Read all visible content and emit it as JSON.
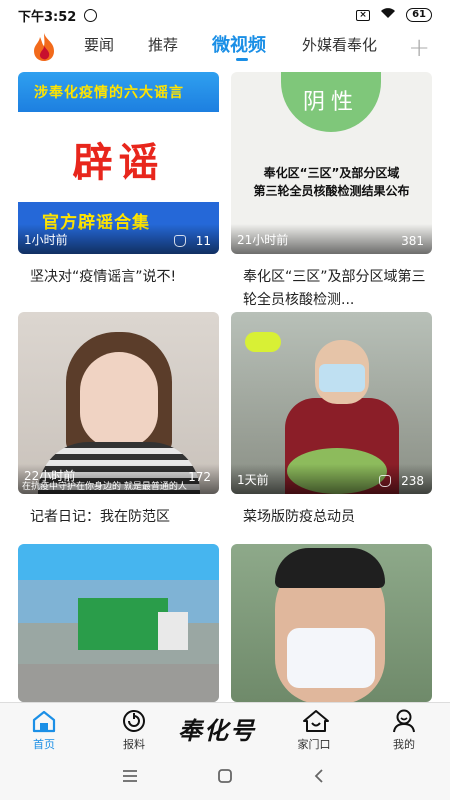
{
  "status_bar": {
    "time": "下午3:52",
    "battery": "61"
  },
  "tabs": [
    {
      "label": "要闻",
      "active": false
    },
    {
      "label": "推荐",
      "active": false
    },
    {
      "label": "微视频",
      "active": true
    },
    {
      "label": "外媒看奉化",
      "active": false
    }
  ],
  "add_tab_icon": "plus-icon",
  "videos": [
    {
      "time": "1小时前",
      "views": "11",
      "title": "坚决对“疫情谣言”说不!",
      "thumb": {
        "banner": "涉奉化疫情的六大谣言",
        "big": "辟谣",
        "footer": "官方辟谣合集"
      }
    },
    {
      "time": "21小时前",
      "views": "381",
      "title": "奉化区“三区”及部分区域第三轮全员核酸检测...",
      "thumb": {
        "badge": "阴性",
        "line1": "奉化区“三区”及部分区域",
        "line2": "第三轮全员核酸检测结果公布"
      }
    },
    {
      "time": "22小时前",
      "views": "172",
      "title": "记者日记：我在防范区",
      "thumb": {
        "subtitle": "在抗疫中守护在你身边的 就是最普通的人"
      }
    },
    {
      "time": "1天前",
      "views": "238",
      "title": "菜场版防疫总动员",
      "thumb": {}
    },
    {
      "time": "",
      "views": "",
      "title": "",
      "thumb": {}
    },
    {
      "time": "",
      "views": "",
      "title": "",
      "thumb": {}
    }
  ],
  "bottom_nav": {
    "home": "首页",
    "report": "报料",
    "brand": "奉化号",
    "home_gate": "家门口",
    "mine": "我的"
  }
}
